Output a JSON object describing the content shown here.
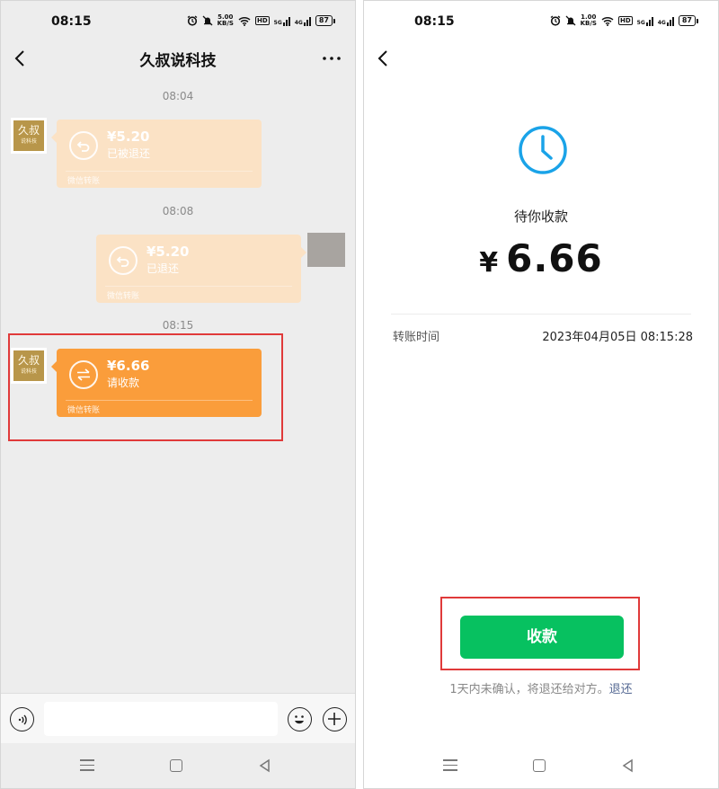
{
  "left": {
    "status": {
      "time": "08:15",
      "speed_top": "5.00",
      "speed_bottom": "KB/S",
      "hd": "HD",
      "net1": "5G",
      "net2": "4G",
      "battery": "87"
    },
    "header": {
      "title": "久叔说科技"
    },
    "avatar": {
      "line1": "久叔",
      "line2": "说科技"
    },
    "messages": [
      {
        "timestamp": "08:04",
        "amount": "¥5.20",
        "status": "已被退还",
        "footer": "微信转账"
      },
      {
        "timestamp": "08:08",
        "amount": "¥5.20",
        "status": "已退还",
        "footer": "微信转账"
      },
      {
        "timestamp": "08:15",
        "amount": "¥6.66",
        "status": "请收款",
        "footer": "微信转账"
      }
    ],
    "input": {
      "placeholder": ""
    }
  },
  "right": {
    "status": {
      "time": "08:15",
      "speed_top": "1.00",
      "speed_bottom": "KB/S",
      "hd": "HD",
      "net1": "5G",
      "net2": "4G",
      "battery": "87"
    },
    "pending_label": "待你收款",
    "currency": "¥",
    "amount": "6.66",
    "transfer_time_label": "转账时间",
    "transfer_time_value": "2023年04月05日 08:15:28",
    "accept_button": "收款",
    "note": "1天内未确认，将退还给对方。",
    "return_link": "退还"
  },
  "colors": {
    "transfer_active": "#fa9d3b",
    "transfer_faded": "#fbe2c5",
    "accept_green": "#07c160",
    "clock_blue": "#1aa3e8",
    "highlight_red": "#e03a3a"
  }
}
